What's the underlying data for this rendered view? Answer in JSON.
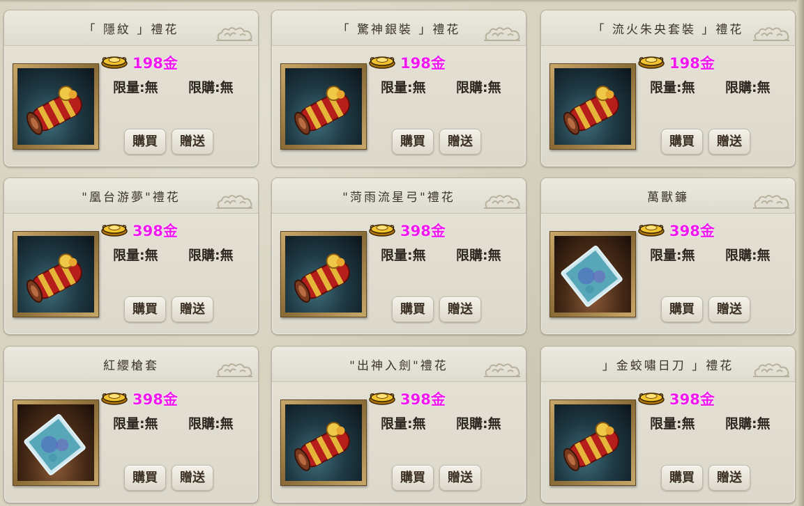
{
  "shop": {
    "currency_icon": "gold-ingot-icon",
    "colors": {
      "price": "#f018ef",
      "card_bg": "#e3dfd3",
      "page_bg": "#d8d3c1"
    },
    "items": [
      {
        "title": "「 隱紋 」禮花",
        "price": "198金",
        "limit_qty": "限量:無",
        "limit_buy": "限購:無",
        "buy_label": "購買",
        "gift_label": "贈送",
        "image": "scroll"
      },
      {
        "title": "「 驚神銀裝 」禮花",
        "price": "198金",
        "limit_qty": "限量:無",
        "limit_buy": "限購:無",
        "buy_label": "購買",
        "gift_label": "贈送",
        "image": "scroll"
      },
      {
        "title": "「 流火朱央套裝 」禮花",
        "price": "198金",
        "limit_qty": "限量:無",
        "limit_buy": "限購:無",
        "buy_label": "購買",
        "gift_label": "贈送",
        "image": "scroll"
      },
      {
        "title": "\"凰台游夢\"禮花",
        "price": "398金",
        "limit_qty": "限量:無",
        "limit_buy": "限購:無",
        "buy_label": "購買",
        "gift_label": "贈送",
        "image": "scroll"
      },
      {
        "title": "\"菏雨流星弓\"禮花",
        "price": "398金",
        "limit_qty": "限量:無",
        "limit_buy": "限購:無",
        "buy_label": "購買",
        "gift_label": "贈送",
        "image": "scroll"
      },
      {
        "title": "萬獸鐮",
        "price": "398金",
        "limit_qty": "限量:無",
        "limit_buy": "限購:無",
        "buy_label": "購買",
        "gift_label": "贈送",
        "image": "book"
      },
      {
        "title": "紅纓槍套",
        "price": "398金",
        "limit_qty": "限量:無",
        "limit_buy": "限購:無",
        "buy_label": "購買",
        "gift_label": "贈送",
        "image": "book"
      },
      {
        "title": "\"出神入劍\"禮花",
        "price": "398金",
        "limit_qty": "限量:無",
        "limit_buy": "限購:無",
        "buy_label": "購買",
        "gift_label": "贈送",
        "image": "scroll"
      },
      {
        "title": "」金蛟嘯日刀 」禮花",
        "price": "398金",
        "limit_qty": "限量:無",
        "limit_buy": "限購:無",
        "buy_label": "購買",
        "gift_label": "贈送",
        "image": "scroll"
      }
    ]
  }
}
